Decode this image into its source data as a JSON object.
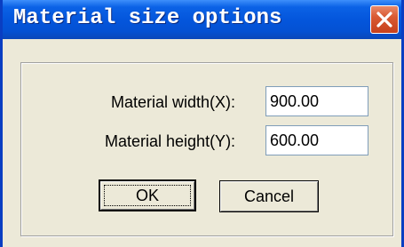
{
  "dialog": {
    "title": "Material size options",
    "close_icon": "close-icon",
    "fields": {
      "width_label": "Material width(X):",
      "width_value": "900.00",
      "height_label": "Material height(Y):",
      "height_value": "600.00"
    },
    "buttons": {
      "ok_label": "OK",
      "cancel_label": "Cancel"
    }
  },
  "colors": {
    "titlebar": "#0456dc",
    "close_button": "#d95a33",
    "dialog_face": "#ece9d8"
  }
}
